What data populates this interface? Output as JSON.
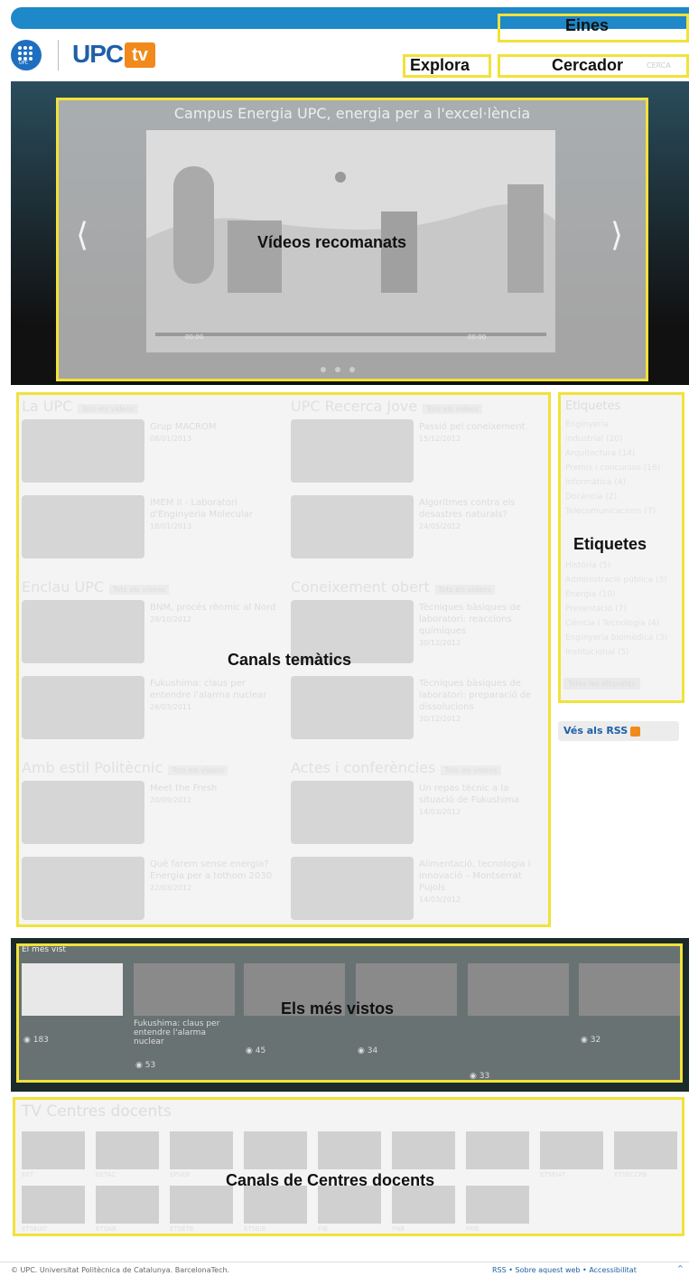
{
  "annotations": {
    "eines": "Eines",
    "explora": "Explora",
    "cercador": "Cercador",
    "videos": "Vídeos recomanats",
    "canals": "Canals temàtics",
    "etiquetes": "Etiquetes",
    "mes_vistos": "Els més vistos",
    "centres": "Canals de Centres docents"
  },
  "search": {
    "button": "CERCA"
  },
  "hero": {
    "title": "Campus Energia UPC, energia per a l'excel·lència",
    "time_left": "00:00",
    "time_right": "00:00",
    "prev": "⟨",
    "next": "⟩"
  },
  "logo": {
    "brand": "UPC",
    "tv": "tv",
    "seal": "UPC"
  },
  "channels": [
    {
      "title": "La UPC",
      "more": "Tots els vídeos",
      "items": [
        {
          "title": "Grup MACROM",
          "date": "08/01/2013"
        },
        {
          "title": "iMEM II - Laboratori d'Enginyeria Molecular",
          "date": "18/01/2013"
        }
      ]
    },
    {
      "title": "UPC Recerca Jove",
      "more": "Tots els vídeos",
      "items": [
        {
          "title": "Passió pel coneixement",
          "date": "15/12/2012"
        },
        {
          "title": "Algoritmes contra els desastres naturals?",
          "date": "24/05/2012"
        }
      ]
    },
    {
      "title": "Enclau UPC",
      "more": "Tots els vídeos",
      "items": [
        {
          "title": "BNM, procés rènmic al Nord",
          "date": "29/10/2012"
        },
        {
          "title": "Fukushima: claus per entendre l'alarma nuclear",
          "date": "26/03/2011"
        }
      ]
    },
    {
      "title": "Coneixement obert",
      "more": "Tots els vídeos",
      "items": [
        {
          "title": "Tècniques bàsiques de laboratori: reaccions químiques",
          "date": "30/12/2012"
        },
        {
          "title": "Tècniques bàsiques de laboratori: preparació de dissolucions",
          "date": "30/12/2012"
        }
      ]
    },
    {
      "title": "Amb estil Politècnic",
      "more": "Tots els vídeos",
      "items": [
        {
          "title": "Meet the Fresh",
          "date": "20/09/2012"
        },
        {
          "title": "Què farem sense energia? Energia per a tothom 2030",
          "date": "22/03/2012"
        }
      ]
    },
    {
      "title": "Actes i conferències",
      "more": "Tots els vídeos",
      "items": [
        {
          "title": "Un repas tècnic a la situació de Fukushima",
          "date": "14/03/2012"
        },
        {
          "title": "Alimentació, tecnologia i innovació – Montserrat Pujols",
          "date": "14/03/2012"
        }
      ]
    }
  ],
  "tags": {
    "title": "Etiquetes",
    "items": [
      "Enginyeria",
      "industrial (20)",
      "Arquitectura (14)",
      "Premis i concursos (16)",
      "Informàtica (4)",
      "Docència (2)",
      "Telecomunicacions (7)",
      "Història (5)",
      "Administració pública (3)",
      "Energia (10)",
      "Presentació (7)",
      "Ciència i Tecnologia (4)",
      "Enginyeria biomèdica (3)",
      "Institucional (5)"
    ],
    "button": "Totes les etiquetes"
  },
  "rss": {
    "label": "Vés als RSS"
  },
  "most_seen": {
    "title": "El més vist",
    "items": [
      {
        "text": "",
        "count": "183"
      },
      {
        "text": "Fukushima: claus per entendre l'alarma nuclear",
        "count": "53"
      },
      {
        "text": "",
        "count": "45"
      },
      {
        "text": "",
        "count": "34"
      },
      {
        "text": "",
        "count": "33"
      },
      {
        "text": "",
        "count": "32"
      }
    ]
  },
  "centres": {
    "title": "TV Centres docents",
    "codes": [
      "EET",
      "EETAC",
      "EPSEB",
      "",
      "",
      "",
      "",
      "ETSEIAT",
      "ETSECCPB",
      "ETSEIAT",
      "ETSAB",
      "ETSETB",
      "ETSEIB",
      "FIB",
      "FNB",
      "FME"
    ]
  },
  "footer": {
    "left": "© UPC. Universitat Politècnica de Catalunya. BarcelonaTech.",
    "right": "RSS • Sobre aquest web • Accessibilitat"
  }
}
